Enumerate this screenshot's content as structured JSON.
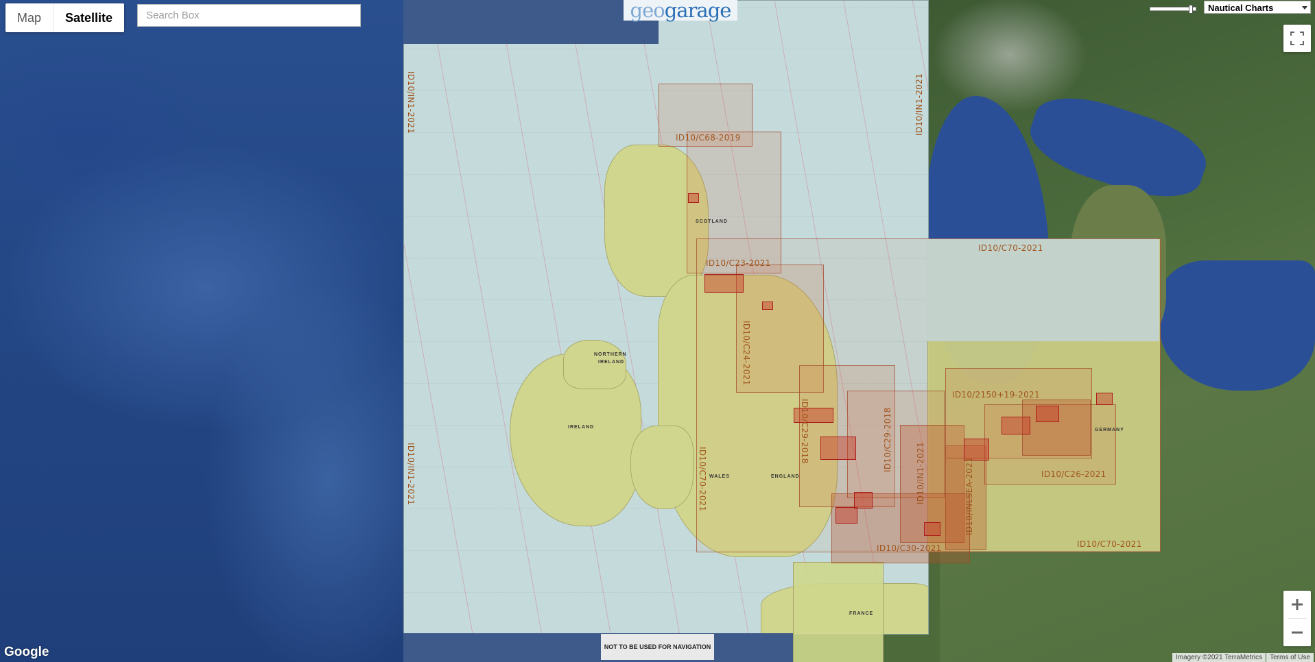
{
  "map_type": {
    "map_label": "Map",
    "satellite_label": "Satellite",
    "active": "Satellite"
  },
  "search": {
    "placeholder": "Search Box",
    "value": ""
  },
  "logo": {
    "text_prefix": "geo",
    "text_suffix": "garage"
  },
  "layer_select": {
    "selected": "Nautical Charts"
  },
  "opacity_slider": {
    "value": 0.92
  },
  "chart_labels": {
    "n1_left_top": "ID10/IN1-2021",
    "n1_left_bottom": "ID10/IN1-2021",
    "n1_right_top": "ID10/IN1-2021",
    "c68": "ID10/C68-2019",
    "c23": "ID10/C23-2021",
    "c24": "ID10/C24-2021",
    "c70_top": "ID10/C70-2021",
    "c70_left": "ID10/C70-2021",
    "c70_bottom": "ID10/C70-2021",
    "c29_a": "ID10/C29-2018",
    "c29_b": "ID10/C29-2018",
    "c2150": "ID10/2150+19-2021",
    "c26": "ID10/C26-2021",
    "in1_mid": "ID10/IN1-2021",
    "inlsea": "ID10/INLSEA-2021",
    "c30": "ID10/C30-2021"
  },
  "place_labels": {
    "scotland": "SCOTLAND",
    "northern_ireland_1": "NORTHERN",
    "northern_ireland_2": "IRELAND",
    "ireland": "IRELAND",
    "wales": "WALES",
    "england": "ENGLAND",
    "france": "FRANCE",
    "germany": "GERMANY"
  },
  "warning": {
    "text": "NOT TO BE USED FOR NAVIGATION"
  },
  "google": {
    "logo": "Google"
  },
  "attribution": {
    "imagery": "Imagery ©2021 TerraMetrics",
    "terms": "Terms of Use"
  },
  "colors": {
    "chart_sea": "#c5dbdb",
    "chart_land": "#d1d68f",
    "chart_overlay": "#d26e46",
    "ocean": "#2a4f8f"
  }
}
